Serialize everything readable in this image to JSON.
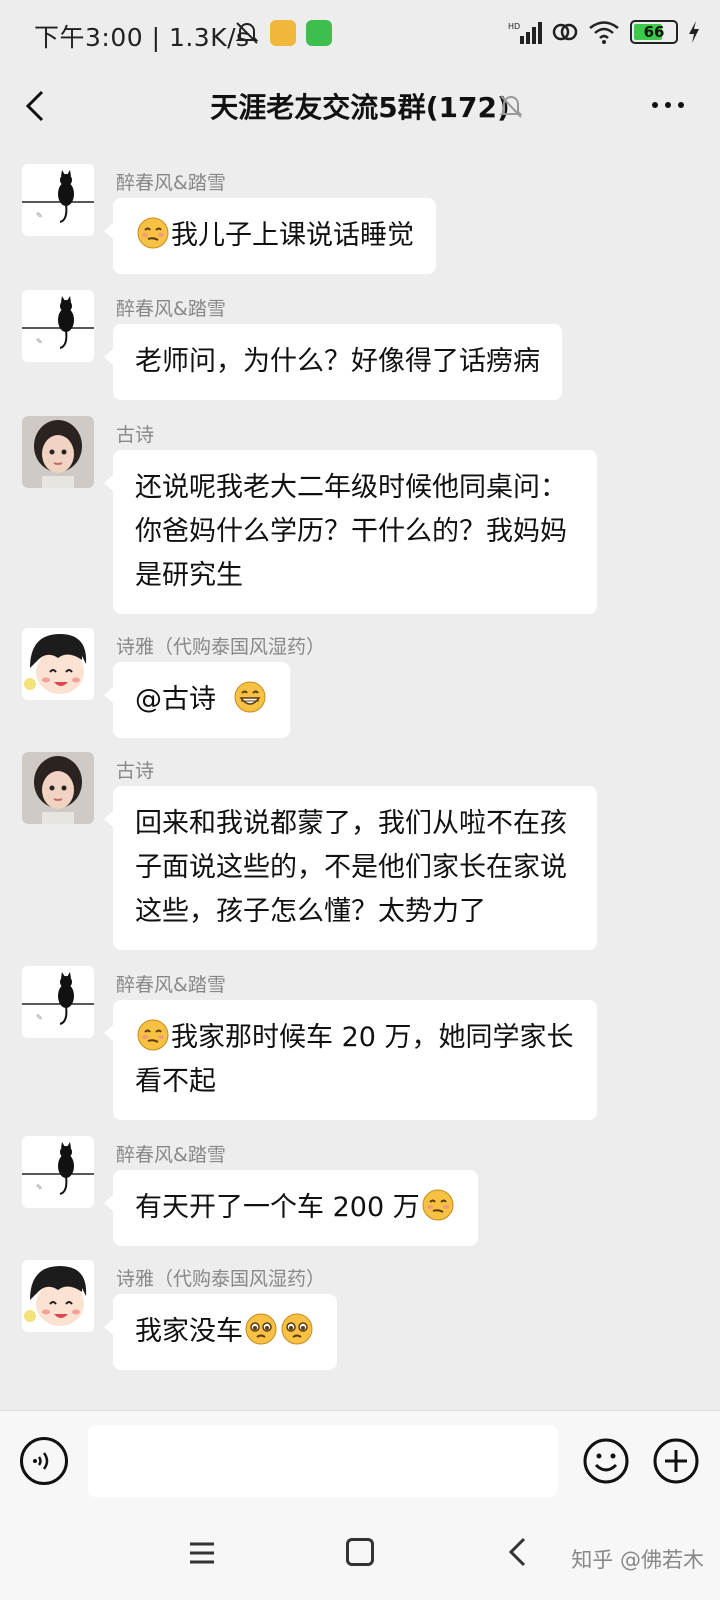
{
  "status_bar": {
    "time": "下午3:00 | 1.3K/s",
    "battery_level": "66"
  },
  "header": {
    "title": "天涯老友交流5群(172)"
  },
  "messages": [
    {
      "sender": "醉春风&踏雪",
      "text": "我儿子上课说话睡觉"
    },
    {
      "sender": "醉春风&踏雪",
      "text": "老师问，为什么？好像得了话痨病"
    },
    {
      "sender": "古诗",
      "text": "还说呢我老大二年级时候他同桌问：你爸妈什么学历？干什么的？我妈妈是研究生"
    },
    {
      "sender": "诗雅（代购泰国风湿药）",
      "text": "@古诗 "
    },
    {
      "sender": "古诗",
      "text": "回来和我说都蒙了，我们从啦不在孩子面说这些的，不是他们家长在家说这些，孩子怎么懂？太势力了"
    },
    {
      "sender": "醉春风&踏雪",
      "text": "我家那时候车 20 万，她同学家长看不起"
    },
    {
      "sender": "醉春风&踏雪",
      "text": "有天开了一个车 200 万"
    },
    {
      "sender": "诗雅（代购泰国风湿药）",
      "text": "我家没车"
    }
  ],
  "input": {
    "placeholder": ""
  },
  "watermark": "知乎 @佛若木",
  "colors": {
    "background": "#ededed",
    "bubble": "#ffffff",
    "sender_name": "#888888",
    "battery_fill": "#3cc94a"
  }
}
